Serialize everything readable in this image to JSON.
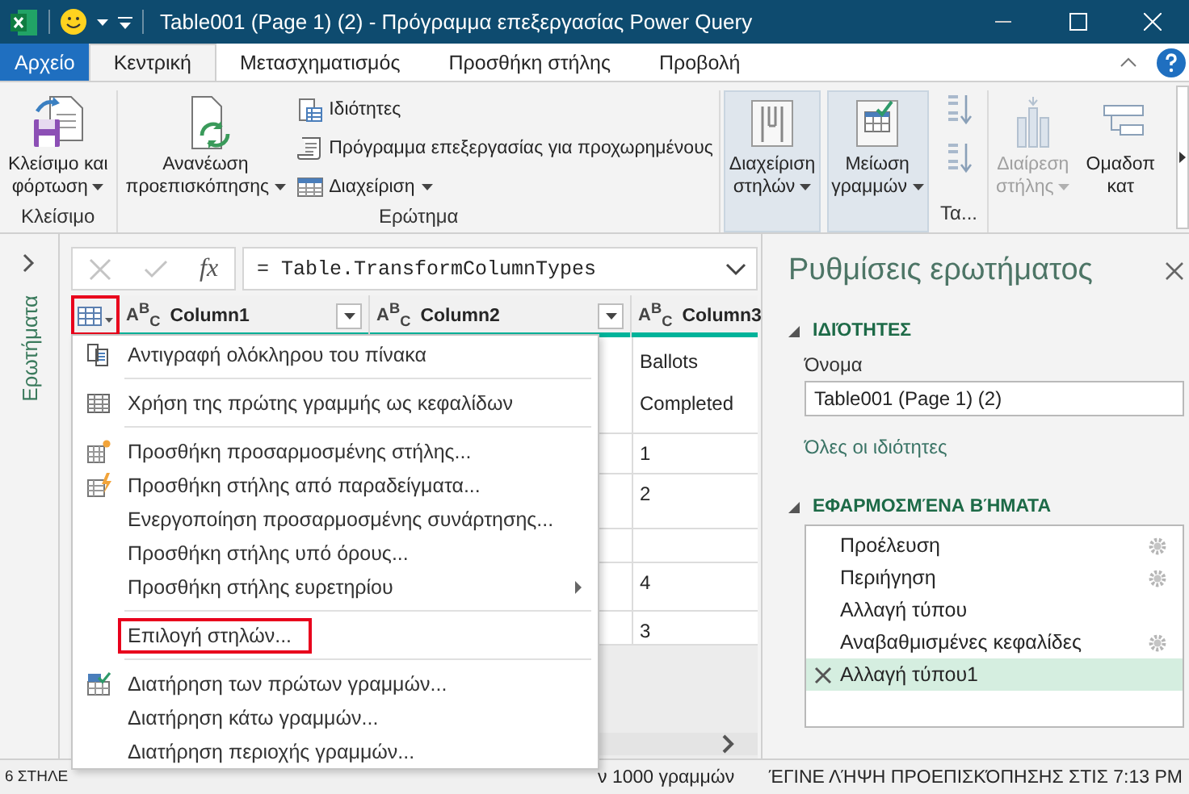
{
  "window": {
    "title": "Table001 (Page 1) (2) - Πρόγραμμα επεξεργασίας Power Query"
  },
  "tabs": [
    {
      "label": "Αρχείο",
      "kind": "file",
      "selected": false
    },
    {
      "label": "Κεντρική",
      "kind": "tab",
      "selected": true
    },
    {
      "label": "Μετασχηματισμός",
      "kind": "tab",
      "selected": false
    },
    {
      "label": "Προσθήκη στήλης",
      "kind": "tab",
      "selected": false
    },
    {
      "label": "Προβολή",
      "kind": "tab",
      "selected": false
    }
  ],
  "ribbon": {
    "close_group": {
      "label": "Κλείσιμο",
      "button": {
        "lines": [
          "Κλείσιμο και",
          "φόρτωση"
        ],
        "dropdown": true
      }
    },
    "query_group": {
      "label": "Ερώτημα",
      "refresh": {
        "lines": [
          "Ανανέωση",
          "προεπισκόπησης"
        ],
        "dropdown": true
      },
      "small_buttons": [
        {
          "label": "Ιδιότητες",
          "dropdown": false
        },
        {
          "label": "Πρόγραμμα επεξεργασίας για προχωρημένους",
          "dropdown": false
        },
        {
          "label": "Διαχείριση",
          "dropdown": true
        }
      ]
    },
    "manage_columns": {
      "lines": [
        "Διαχείριση",
        "στηλών"
      ],
      "dropdown": true,
      "pressed": true
    },
    "reduce_rows": {
      "lines": [
        "Μείωση",
        "γραμμών"
      ],
      "dropdown": true,
      "pressed": true
    },
    "sort_group": {
      "label": "Τα..."
    },
    "split_column": {
      "lines": [
        "Διαίρεση",
        "στήλης"
      ],
      "dropdown": true,
      "disabled": true
    },
    "group_by": {
      "lines": [
        "Ομαδοπ",
        "κατ"
      ]
    }
  },
  "queries_pane": {
    "label": "Ερωτήματα"
  },
  "formula_bar": {
    "fx": "fx",
    "formula": "= Table.TransformColumnTypes",
    "buttons_disabled": true
  },
  "table": {
    "menu_button_highlighted": true,
    "columns": [
      {
        "type": "A$^{B}$$_{C}$",
        "name": "Column1"
      },
      {
        "type": "A$^{B}$$_{C}$",
        "name": "Column2"
      },
      {
        "type": "A$^{B}$$_{C}$",
        "name": "Column3"
      }
    ],
    "column_3_cells": [
      "Ballots Completed",
      "1",
      "2",
      "",
      "4",
      "3"
    ]
  },
  "context_menu": {
    "groups": [
      [
        {
          "label": "Αντιγραφή ολόκληρου του πίνακα",
          "kind": "copy",
          "highlighted": false
        }
      ],
      [
        {
          "label": "Χρήση της πρώτης γραμμής ως κεφαλίδων",
          "kind": "headers",
          "highlighted": false
        }
      ],
      [
        {
          "label": "Προσθήκη προσαρμοσμένης στήλης...",
          "kind": "custom",
          "highlighted": false
        },
        {
          "label": "Προσθήκη στήλης από παραδείγματα...",
          "kind": "examples",
          "highlighted": false
        },
        {
          "label": "Ενεργοποίηση προσαρμοσμένης συνάρτησης...",
          "kind": "plain",
          "highlighted": false
        },
        {
          "label": "Προσθήκη στήλης υπό όρους...",
          "kind": "plain",
          "highlighted": false
        },
        {
          "label": "Προσθήκη στήλης ευρετηρίου",
          "kind": "submenu",
          "highlighted": false
        }
      ],
      [
        {
          "label": "Επιλογή στηλών...",
          "kind": "plain",
          "highlighted": true
        }
      ],
      [
        {
          "label": "Διατήρηση των πρώτων γραμμών...",
          "kind": "keep",
          "highlighted": false
        },
        {
          "label": "Διατήρηση κάτω γραμμών...",
          "kind": "plain",
          "highlighted": false
        },
        {
          "label": "Διατήρηση περιοχής γραμμών...",
          "kind": "plain",
          "highlighted": false
        }
      ]
    ]
  },
  "query_settings": {
    "title": "Ρυθμίσεις ερωτήματος",
    "properties_heading": "ΙΔΙΌΤΗΤΕΣ",
    "name_label": "Όνομα",
    "name_value": "Table001 (Page 1) (2)",
    "all_properties_link": "Όλες οι ιδιότητες",
    "steps_heading": "ΕΦΑΡΜΟΣΜΈΝΑ ΒΉΜΑΤΑ",
    "steps": [
      {
        "label": "Προέλευση",
        "has_settings": true,
        "selected": false
      },
      {
        "label": "Περιήγηση",
        "has_settings": true,
        "selected": false
      },
      {
        "label": "Αλλαγή τύπου",
        "has_settings": false,
        "selected": false
      },
      {
        "label": "Αναβαθμισμένες κεφαλίδες",
        "has_settings": true,
        "selected": false
      },
      {
        "label": "Αλλαγή τύπου1",
        "has_settings": false,
        "selected": true
      }
    ]
  },
  "status_bar": {
    "left": "6 ΣΤΗΛΕ",
    "middle": "ν 1000 γραμμών",
    "right": "ΈΓΙΝΕ ΛΉΨΗ ΠΡΟΕΠΙΣΚΌΠΗΣΗΣ ΣΤΙΣ 7:13 PM"
  }
}
